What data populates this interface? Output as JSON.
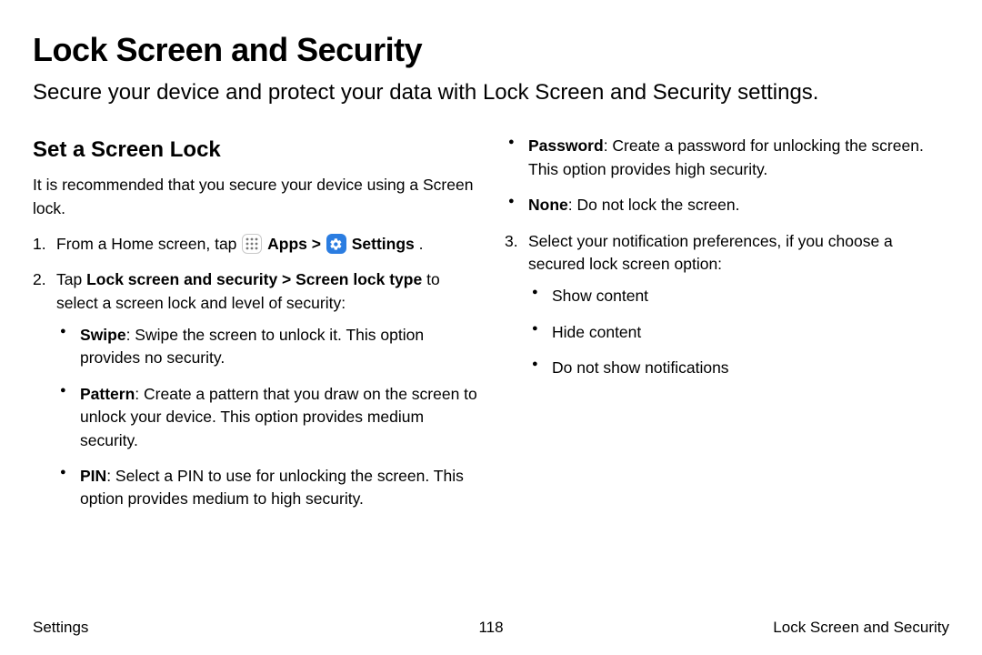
{
  "title": "Lock Screen and Security",
  "intro": "Secure your device and protect your data with Lock Screen and Security settings.",
  "section": "Set a Screen Lock",
  "lead": "It is recommended that you secure your device using a Screen lock.",
  "step1": {
    "pre": "From a Home screen, tap ",
    "apps": "Apps",
    "sep": " > ",
    "settings": "Settings",
    "post": " ."
  },
  "step2": {
    "pre": "Tap ",
    "bold": "Lock screen and security > Screen lock type",
    "post": " to select a screen lock and level of security:"
  },
  "opts": {
    "swipe_b": "Swipe",
    "swipe_t": ": Swipe the screen to unlock it. This option provides no security.",
    "pattern_b": "Pattern",
    "pattern_t": ": Create a pattern that you draw on the screen to unlock your device. This option provides medium security.",
    "pin_b": "PIN",
    "pin_t": ": Select a PIN to use for unlocking the screen. This option provides medium to high security.",
    "password_b": "Password",
    "password_t": ": Create a password for unlocking the screen. This option provides high security.",
    "none_b": "None",
    "none_t": ": Do not lock the screen."
  },
  "step3": "Select your notification preferences, if you choose a secured lock screen option:",
  "notif": {
    "a": "Show content",
    "b": "Hide content",
    "c": "Do not show notifications"
  },
  "footer": {
    "left": "Settings",
    "center": "118",
    "right": "Lock Screen and Security"
  }
}
